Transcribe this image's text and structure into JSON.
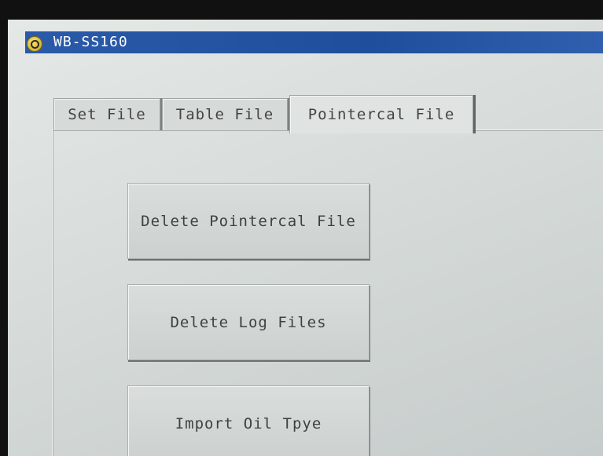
{
  "window": {
    "title": "WB-SS160"
  },
  "tabs": [
    {
      "label": "Set File"
    },
    {
      "label": "Table File"
    },
    {
      "label": "Pointercal File"
    }
  ],
  "buttons": {
    "delete_pointercal": "Delete Pointercal File",
    "delete_logs": "Delete Log Files",
    "import_oil": "Import Oil Tpye"
  },
  "colors": {
    "titlebar": "#2a5aa8",
    "background": "#d7dcda"
  },
  "icons": {
    "app": "app-logo-icon"
  }
}
